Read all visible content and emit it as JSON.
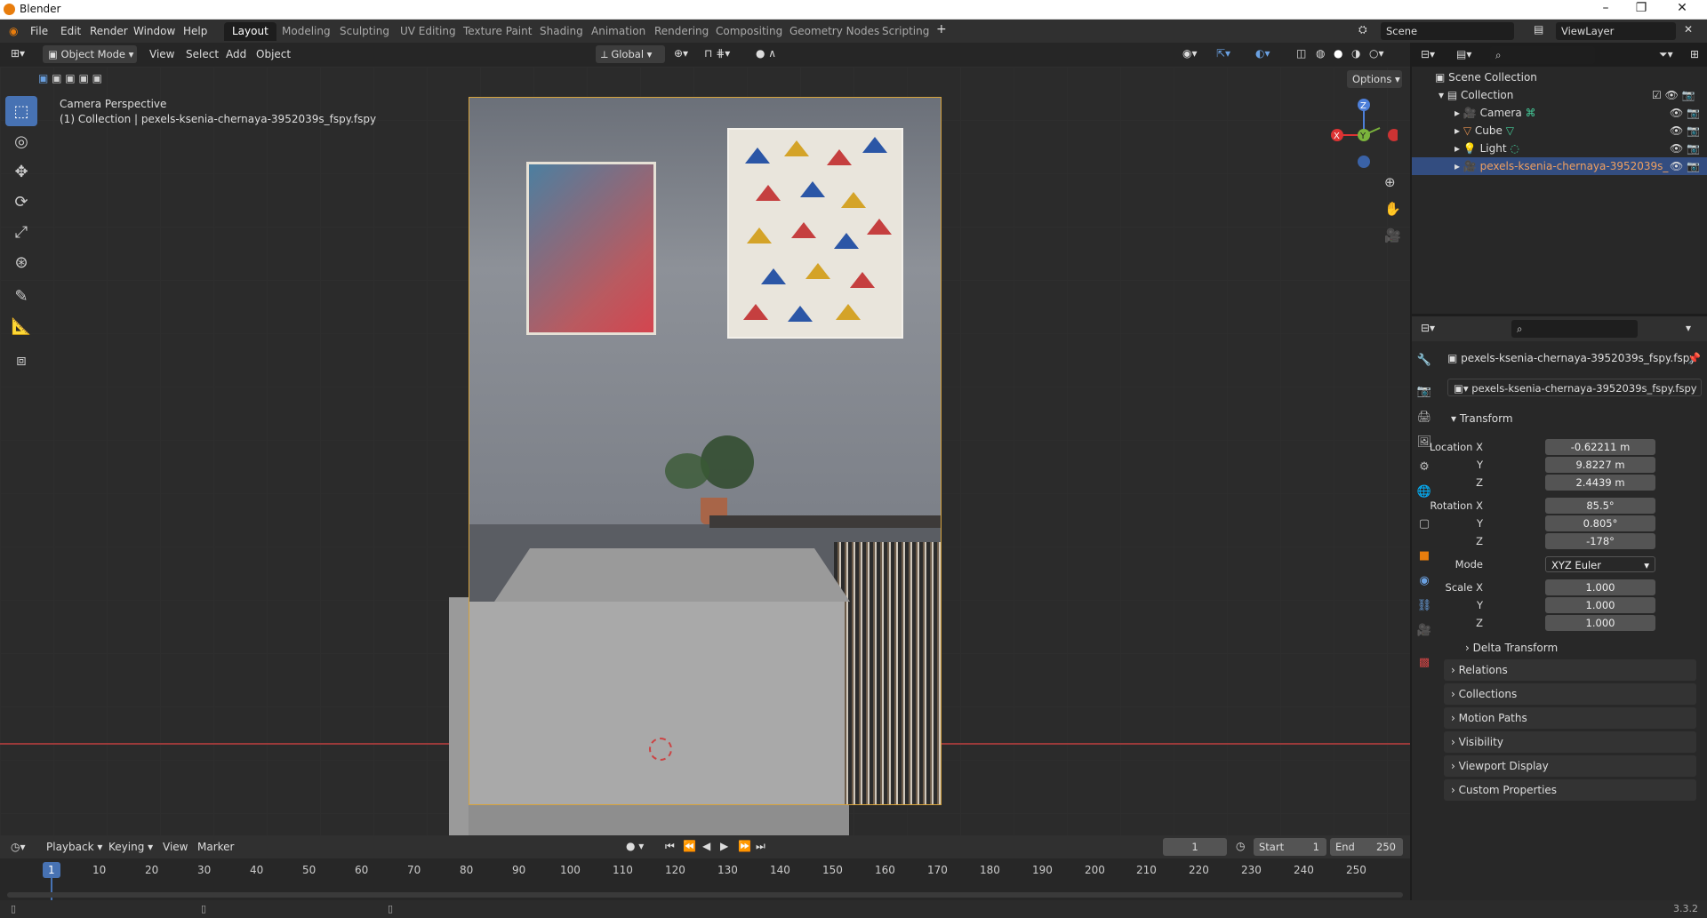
{
  "app": {
    "title": "Blender",
    "version": "3.3.2"
  },
  "menu": [
    "File",
    "Edit",
    "Render",
    "Window",
    "Help"
  ],
  "workspaces": [
    "Layout",
    "Modeling",
    "Sculpting",
    "UV Editing",
    "Texture Paint",
    "Shading",
    "Animation",
    "Rendering",
    "Compositing",
    "Geometry Nodes",
    "Scripting"
  ],
  "active_workspace": "Layout",
  "scene": {
    "name": "Scene",
    "view_layer": "ViewLayer"
  },
  "viewport_header": {
    "mode": "Object Mode",
    "menus": [
      "View",
      "Select",
      "Add",
      "Object"
    ],
    "orientation": "Global",
    "options_label": "Options"
  },
  "viewport": {
    "overlay_title": "Camera Perspective",
    "overlay_subtitle": "(1) Collection | pexels-ksenia-chernaya-3952039s_fspy.fspy"
  },
  "outliner": {
    "root": "Scene Collection",
    "collection": "Collection",
    "items": [
      "Camera",
      "Cube",
      "Light",
      "pexels-ksenia-chernaya-3952039s_"
    ]
  },
  "properties": {
    "object_name": "pexels-ksenia-chernaya-3952039s_fspy.fspy",
    "data_name": "pexels-ksenia-chernaya-3952039s_fspy.fspy",
    "transform_label": "Transform",
    "location_label": "Location X",
    "rotation_label": "Rotation X",
    "scale_label": "Scale X",
    "axis_y": "Y",
    "axis_z": "Z",
    "mode_label": "Mode",
    "location": [
      "-0.62211 m",
      "9.8227 m",
      "2.4439 m"
    ],
    "rotation": [
      "85.5°",
      "0.805°",
      "-178°"
    ],
    "rotation_mode": "XYZ Euler",
    "scale": [
      "1.000",
      "1.000",
      "1.000"
    ],
    "delta_transform": "Delta Transform",
    "panels": [
      "Relations",
      "Collections",
      "Motion Paths",
      "Visibility",
      "Viewport Display",
      "Custom Properties"
    ]
  },
  "timeline": {
    "menus": [
      "Playback",
      "Keying",
      "View",
      "Marker"
    ],
    "current_frame": "1",
    "start_label": "Start",
    "start": "1",
    "end_label": "End",
    "end": "250",
    "ticks": [
      "1",
      "10",
      "20",
      "30",
      "40",
      "50",
      "60",
      "70",
      "80",
      "90",
      "100",
      "110",
      "120",
      "130",
      "140",
      "150",
      "160",
      "170",
      "180",
      "190",
      "200",
      "210",
      "220",
      "230",
      "240",
      "250"
    ]
  },
  "colors": {
    "accent": "#4772b3",
    "camera_frame": "#d6a33c",
    "selection": "#334d80"
  }
}
